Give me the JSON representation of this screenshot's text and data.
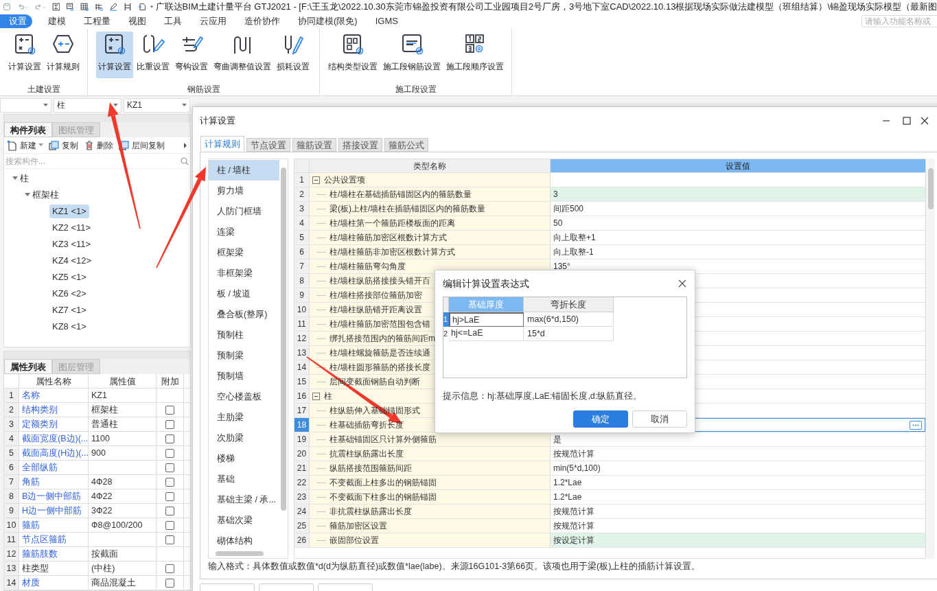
{
  "title_bar": {
    "title": "广联达BIM土建计量平台 GTJ2021 - [F:\\王玉龙\\2022.10.30东莞市锦盈投资有限公司工业园项目2号厂房，3号地下室CAD\\2022.10.13根据现场实际做法建模型（班组结算）\\锦盈现场实际模型（最新图"
  },
  "menu": [
    {
      "label": "设置",
      "selected": true
    },
    {
      "label": "建模",
      "selected": false
    },
    {
      "label": "工程量",
      "selected": false
    },
    {
      "label": "视图",
      "selected": false
    },
    {
      "label": "工具",
      "selected": false
    },
    {
      "label": "云应用",
      "selected": false
    },
    {
      "label": "造价协作",
      "selected": false
    },
    {
      "label": "协同建模(限免)",
      "selected": false
    },
    {
      "label": "IGMS",
      "selected": false
    }
  ],
  "search": {
    "placeholder": "请输入功能名称或"
  },
  "ribbon": [
    {
      "title": "土建设置",
      "buttons": [
        {
          "label": "计算设置",
          "selected": false
        },
        {
          "label": "计算规则",
          "selected": false
        }
      ]
    },
    {
      "title": "钢筋设置",
      "buttons": [
        {
          "label": "计算设置",
          "selected": true
        },
        {
          "label": "比重设置",
          "selected": false
        },
        {
          "label": "弯钩设置",
          "selected": false
        },
        {
          "label": "弯曲调整值设置",
          "selected": false
        },
        {
          "label": "损耗设置",
          "selected": false
        }
      ]
    },
    {
      "title": "施工段设置",
      "buttons": [
        {
          "label": "结构类型设置",
          "selected": false
        },
        {
          "label": "施工段钢筋设置",
          "selected": false
        },
        {
          "label": "施工段顺序设置",
          "selected": false
        }
      ]
    }
  ],
  "selectors": [
    {
      "value": "柱"
    },
    {
      "value": "KZ1"
    }
  ],
  "component_panel": {
    "tabs": [
      {
        "label": "构件列表",
        "selected": true
      },
      {
        "label": "图纸管理",
        "selected": false
      }
    ],
    "toolbar": [
      "新建",
      "复制",
      "删除",
      "层间复制"
    ],
    "search": {
      "placeholder": "搜索构件..."
    },
    "tree": [
      {
        "label": "柱",
        "expanded": true,
        "children": [
          {
            "label": "框架柱",
            "expanded": true,
            "children": [
              {
                "label": "KZ1 <1>",
                "selected": true
              },
              {
                "label": "KZ2 <11>",
                "selected": false
              },
              {
                "label": "KZ3 <11>",
                "selected": false
              },
              {
                "label": "KZ4 <12>",
                "selected": false
              },
              {
                "label": "KZ5 <1>",
                "selected": false
              },
              {
                "label": "KZ6 <2>",
                "selected": false
              },
              {
                "label": "KZ7 <1>",
                "selected": false
              },
              {
                "label": "KZ8 <1>",
                "selected": false
              }
            ]
          }
        ]
      }
    ]
  },
  "property_panel": {
    "tabs": [
      {
        "label": "属性列表",
        "selected": true
      },
      {
        "label": "图层管理",
        "selected": false
      }
    ],
    "columns": [
      "属性名称",
      "属性值",
      "附加"
    ],
    "rows": [
      {
        "index": "1",
        "name": "名称",
        "value": "KZ1",
        "public": true
      },
      {
        "index": "2",
        "name": "结构类别",
        "value": "框架柱",
        "public": true,
        "checked": false
      },
      {
        "index": "3",
        "name": "定额类别",
        "value": "普通柱",
        "public": true,
        "checked": false
      },
      {
        "index": "4",
        "name": "截面宽度(B边)(...",
        "value": "1100",
        "public": true,
        "checked": false
      },
      {
        "index": "5",
        "name": "截面高度(H边)(...",
        "value": "900",
        "public": true,
        "checked": false
      },
      {
        "index": "6",
        "name": "全部纵筋",
        "public": true,
        "checked": false
      },
      {
        "index": "7",
        "name": "角筋",
        "value": "4Ф28",
        "public": true,
        "checked": false
      },
      {
        "index": "8",
        "name": "B边一侧中部筋",
        "value": "4Ф22",
        "public": true,
        "checked": false
      },
      {
        "index": "9",
        "name": "H边一侧中部筋",
        "value": "3Ф22",
        "public": true,
        "checked": false
      },
      {
        "index": "10",
        "name": "箍筋",
        "value": "Ф8@100/200",
        "public": true,
        "checked": false
      },
      {
        "index": "11",
        "name": "节点区箍筋",
        "public": true,
        "checked": false
      },
      {
        "index": "12",
        "name": "箍筋肢数",
        "value": "按截面",
        "public": true
      },
      {
        "index": "13",
        "name": "柱类型",
        "value": "(中柱)",
        "public": false,
        "checked": false
      },
      {
        "index": "14",
        "name": "材质",
        "value": "商品混凝土",
        "public": true,
        "checked": false
      }
    ]
  },
  "dialog": {
    "title": "计算设置",
    "tabs": [
      {
        "label": "计算规则",
        "selected": true
      },
      {
        "label": "节点设置",
        "selected": false
      },
      {
        "label": "箍筋设置",
        "selected": false
      },
      {
        "label": "搭接设置",
        "selected": false
      },
      {
        "label": "箍筋公式",
        "selected": false
      }
    ],
    "categories": [
      {
        "label": "柱 / 墙柱",
        "selected": true
      },
      {
        "label": "剪力墙",
        "selected": false
      },
      {
        "label": "人防门框墙",
        "selected": false
      },
      {
        "label": "连梁",
        "selected": false
      },
      {
        "label": "框架梁",
        "selected": false
      },
      {
        "label": "非框架梁",
        "selected": false
      },
      {
        "label": "板 / 坡道",
        "selected": false
      },
      {
        "label": "叠合板(整厚)",
        "selected": false
      },
      {
        "label": "预制柱",
        "selected": false
      },
      {
        "label": "预制梁",
        "selected": false
      },
      {
        "label": "预制墙",
        "selected": false
      },
      {
        "label": "空心楼盖板",
        "selected": false
      },
      {
        "label": "主肋梁",
        "selected": false
      },
      {
        "label": "次肋梁",
        "selected": false
      },
      {
        "label": "楼梯",
        "selected": false
      },
      {
        "label": "基础",
        "selected": false
      },
      {
        "label": "基础主梁 / 承...",
        "selected": false
      },
      {
        "label": "基础次梁",
        "selected": false
      },
      {
        "label": "砌体结构",
        "selected": false
      }
    ],
    "table": {
      "columns": [
        "类型名称",
        "设置值"
      ],
      "rows": [
        {
          "index": "1",
          "kind": "section",
          "name": "公共设置项",
          "expanded": true
        },
        {
          "index": "2",
          "kind": "item",
          "name": "柱/墙柱在基础插筋锚固区内的箍筋数量",
          "value": "3",
          "changed": true,
          "selected": false
        },
        {
          "index": "3",
          "kind": "item",
          "name": "梁(板)上柱/墙柱在插筋锚固区内的箍筋数量",
          "value": "间距500",
          "changed": false,
          "selected": false
        },
        {
          "index": "4",
          "kind": "item",
          "name": "柱/墙柱第一个箍筋距楼板面的距离",
          "value": "50",
          "changed": false,
          "selected": false
        },
        {
          "index": "5",
          "kind": "item",
          "name": "柱/墙柱箍筋加密区根数计算方式",
          "value": "向上取整+1",
          "changed": false,
          "selected": false
        },
        {
          "index": "6",
          "kind": "item",
          "name": "柱/墙柱箍筋非加密区根数计算方式",
          "value": "向上取整-1",
          "changed": false,
          "selected": false
        },
        {
          "index": "7",
          "kind": "item",
          "name": "柱/墙柱箍筋弯勾角度",
          "value": "135°",
          "changed": false,
          "selected": false
        },
        {
          "index": "8",
          "kind": "item",
          "name": "柱/墙柱纵筋搭接接头错开百",
          "changed": false,
          "selected": false
        },
        {
          "index": "9",
          "kind": "item",
          "name": "柱/墙柱搭接部位箍筋加密",
          "changed": false,
          "selected": false
        },
        {
          "index": "10",
          "kind": "item",
          "name": "柱/墙柱纵筋错开距离设置",
          "changed": false,
          "selected": false
        },
        {
          "index": "11",
          "kind": "item",
          "name": "柱/墙柱箍筋加密范围包含错",
          "changed": false,
          "selected": false
        },
        {
          "index": "12",
          "kind": "item",
          "name": "绑扎搭接范围内的箍筋间距m",
          "changed": false,
          "selected": false
        },
        {
          "index": "13",
          "kind": "item",
          "name": "柱/墙柱螺旋箍筋是否连续通",
          "changed": false,
          "selected": false
        },
        {
          "index": "14",
          "kind": "item",
          "name": "柱/墙柱圆形箍筋的搭接长度",
          "changed": false,
          "selected": false
        },
        {
          "index": "15",
          "kind": "item",
          "name": "层间变截面钢筋自动判断",
          "changed": false,
          "selected": false
        },
        {
          "index": "16",
          "kind": "section",
          "name": "柱",
          "expanded": true
        },
        {
          "index": "17",
          "kind": "item",
          "name": "柱纵筋伸入基础锚固形式",
          "changed": false,
          "selected": false
        },
        {
          "index": "18",
          "kind": "item",
          "name": "柱基础插筋弯折长度",
          "changed": false,
          "selected": true
        },
        {
          "index": "19",
          "kind": "item",
          "name": "柱基础锚固区只计算外侧箍筋",
          "value": "是",
          "changed": false,
          "selected": false
        },
        {
          "index": "20",
          "kind": "item",
          "name": "抗震柱纵筋露出长度",
          "value": "按规范计算",
          "changed": false,
          "selected": false
        },
        {
          "index": "21",
          "kind": "item",
          "name": "纵筋搭接范围箍筋间距",
          "value": "min(5*d,100)",
          "changed": false,
          "selected": false
        },
        {
          "index": "22",
          "kind": "item",
          "name": "不变截面上柱多出的钢筋锚固",
          "value": "1.2*Lae",
          "changed": false,
          "selected": false
        },
        {
          "index": "23",
          "kind": "item",
          "name": "不变截面下柱多出的钢筋锚固",
          "value": "1.2*Lae",
          "changed": false,
          "selected": false
        },
        {
          "index": "24",
          "kind": "item",
          "name": "非抗震柱纵筋露出长度",
          "value": "按规范计算",
          "changed": false,
          "selected": false
        },
        {
          "index": "25",
          "kind": "item",
          "name": "箍筋加密区设置",
          "value": "按规范计算",
          "changed": false,
          "selected": false
        },
        {
          "index": "26",
          "kind": "item",
          "name": "嵌固部位设置",
          "value": "按设定计算",
          "changed": true,
          "selected": false
        }
      ]
    },
    "hint": "输入格式：具体数值或数值*d(d为纵筋直径)或数值*lae(labe)。来源16G101-3第66页。该项也用于梁(板)上柱的插筋计算设置。"
  },
  "expression_dialog": {
    "title": "编辑计算设置表达式",
    "columns": [
      {
        "label": "基础厚度",
        "selected": true
      },
      {
        "label": "弯折长度",
        "selected": false
      }
    ],
    "rows": [
      {
        "index": "1",
        "condition": "hj>LaE",
        "value": "max(6*d,150)",
        "selected": true
      },
      {
        "index": "2",
        "condition": "hj<=LaE",
        "value": "15*d",
        "selected": false
      }
    ],
    "hint": "提示信息：hj:基础厚度,LaE:锚固长度,d:纵筋直径。",
    "buttons": [
      {
        "label": "确定",
        "kind": "primary"
      },
      {
        "label": "取消",
        "kind": "secondary"
      }
    ]
  }
}
